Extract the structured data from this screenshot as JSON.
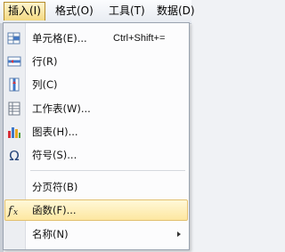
{
  "menubar": {
    "items": [
      {
        "label": "插入(I)",
        "open": true
      },
      {
        "label": "格式(O)"
      },
      {
        "label": "工具(T)"
      },
      {
        "label": "数据(D)"
      }
    ]
  },
  "menu": {
    "items": [
      {
        "label": "单元格(E)...",
        "shortcut": "Ctrl+Shift+=",
        "icon": "cell-icon"
      },
      {
        "label": "行(R)",
        "icon": "row-icon"
      },
      {
        "label": "列(C)",
        "icon": "column-icon"
      },
      {
        "label": "工作表(W)...",
        "icon": "worksheet-icon"
      },
      {
        "label": "图表(H)...",
        "icon": "chart-icon"
      },
      {
        "label": "符号(S)...",
        "icon": "omega-icon"
      },
      {
        "label": "分页符(B)"
      },
      {
        "label": "函数(F)...",
        "icon": "function-icon",
        "highlighted": true
      },
      {
        "label": "名称(N)",
        "submenu": true
      }
    ]
  }
}
